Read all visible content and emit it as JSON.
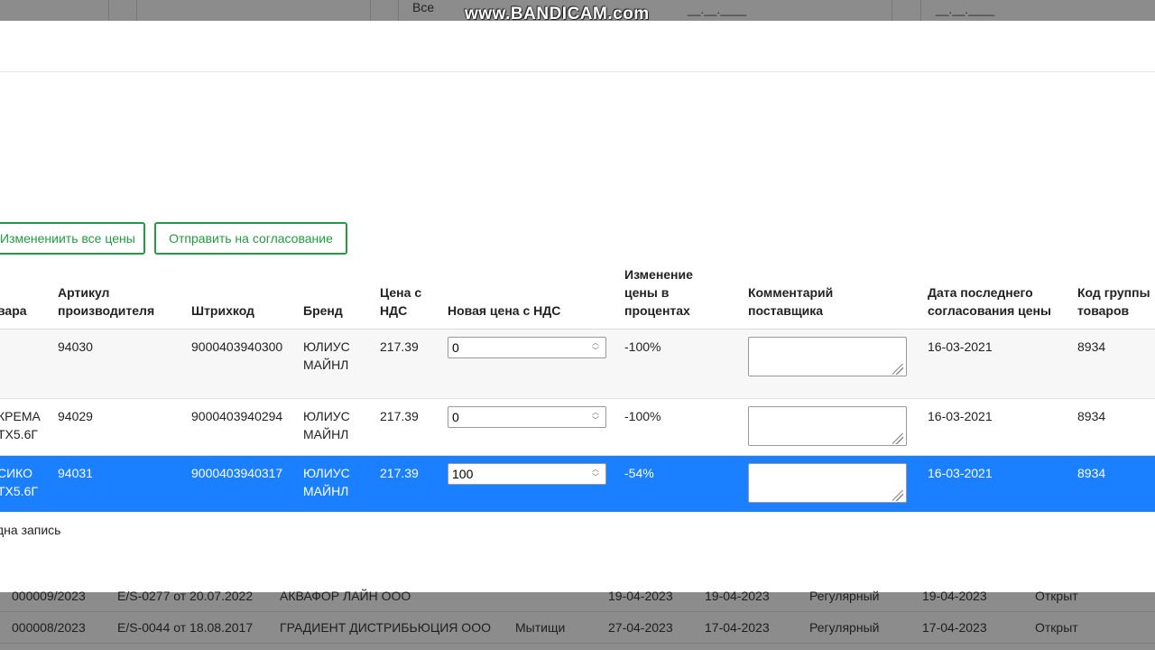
{
  "watermark": "www.BANDICAM.com",
  "background_top": {
    "filter_all": "Все",
    "date_placeholder_1": "__.__.____",
    "date_placeholder_2": "__.__.____"
  },
  "background_rows": [
    {
      "number": "000009/2023",
      "contract": "E/S-0277 от 20.07.2022",
      "supplier": "АКВАФОР ЛАЙН ООО",
      "city": "",
      "date1": "19-04-2023",
      "date2": "19-04-2023",
      "type": "Регулярный",
      "date3": "19-04-2023",
      "status": "Открыт"
    },
    {
      "number": "000008/2023",
      "contract": "E/S-0044 от 18.08.2017",
      "supplier": "ГРАДИЕНТ ДИСТРИБЬЮЦИЯ ООО",
      "city": "Мытищи",
      "date1": "27-04-2023",
      "date2": "17-04-2023",
      "type": "Регулярный",
      "date3": "17-04-2023",
      "status": "Открыт"
    }
  ],
  "toolbar": {
    "change_all_label": "Изменениить все цены",
    "send_label": "Отправить на согласование"
  },
  "table": {
    "headers": {
      "name": "вара",
      "article": "Артикул производителя",
      "barcode": "Штрихкод",
      "brand": "Бренд",
      "price": "Цена с НДС",
      "new_price": "Новая цена с НДС",
      "change_pct": "Изменение цены в процентах",
      "comment": "Комментарий поставщика",
      "last_date": "Дата последнего согласования цены",
      "group_code": "Код группы товаров"
    },
    "rows": [
      {
        "name": "",
        "article": "94030",
        "barcode": "9000403940300",
        "brand": "ЮЛИУС МАЙНЛ",
        "price": "217.39",
        "new_price": "0",
        "change_pct": "-100%",
        "comment": "",
        "last_date": "16-03-2021",
        "group_code": "8934"
      },
      {
        "name": "КРЕМА\nТХ5.6Г",
        "article": "94029",
        "barcode": "9000403940294",
        "brand": "ЮЛИУС МАЙНЛ",
        "price": "217.39",
        "new_price": "0",
        "change_pct": "-100%",
        "comment": "",
        "last_date": "16-03-2021",
        "group_code": "8934"
      },
      {
        "name": "СИКО\nТХ5.6Г",
        "article": "94031",
        "barcode": "9000403940317",
        "brand": "ЮЛИУС МАЙНЛ",
        "price": "217.39",
        "new_price": "100",
        "change_pct": "-54%",
        "comment": "",
        "last_date": "16-03-2021",
        "group_code": "8934"
      }
    ]
  },
  "footer": {
    "record_count": "дна запись"
  },
  "colors": {
    "accent": "#1f9d3f",
    "selected_row": "#1a80ff"
  }
}
